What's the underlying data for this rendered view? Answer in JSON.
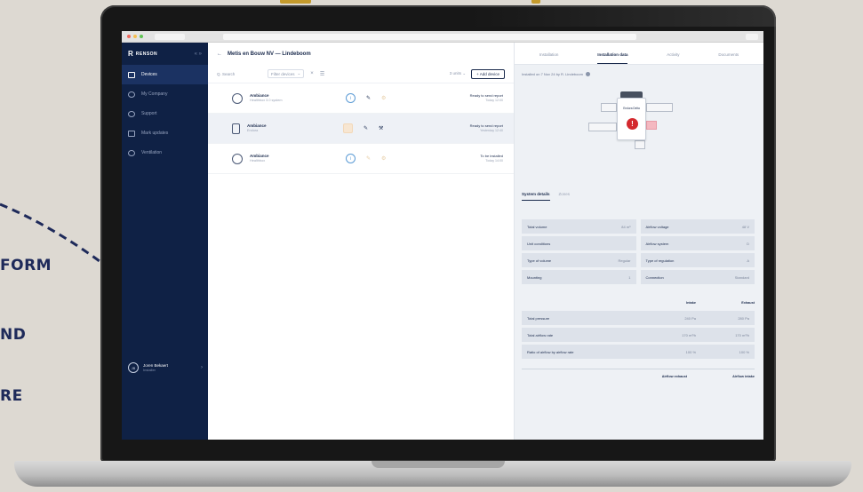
{
  "background": {
    "words": [
      "FORM",
      "ND",
      "RE"
    ],
    "colors": {
      "text": "#1e2a5a",
      "accent": "#c49a2c",
      "page": "#ddd9d2"
    }
  },
  "brand": {
    "mark": "R",
    "name": "RENSON",
    "toggle": "« »"
  },
  "sidebar": {
    "items": [
      {
        "label": "Devices",
        "icon": "devices-icon",
        "active": true
      },
      {
        "label": "My Company",
        "icon": "company-icon"
      },
      {
        "label": "Support",
        "icon": "support-icon"
      },
      {
        "label": "Mark updates",
        "icon": "updates-icon"
      },
      {
        "label": "Ventilation",
        "icon": "ventilation-icon"
      }
    ],
    "user": {
      "initials": "JB",
      "name": "Joren Bekaert",
      "sub": "Installer",
      "chevron": "›"
    }
  },
  "main": {
    "back": "←",
    "title": "Metis en Bouw NV — Lindeboom",
    "search_placeholder": "Q. Search",
    "search_icon": "⌕",
    "filter_label": "Filter devices",
    "filter_chevron": "⌄",
    "filter_close": "×",
    "sort_icon": "☰",
    "count_label": "3 units",
    "count_chevron": "⌄",
    "add_label": "+ Add device",
    "devices": [
      {
        "name": "Ambiance",
        "sub": "Healthbox 3.0 system",
        "status_icon": "i",
        "tool_icon": "✎",
        "extra_icon": "⚙",
        "status_main": "Ready to send report",
        "status_sub": "Today 12:00",
        "icon_shape": "round",
        "selected": false
      },
      {
        "name": "Ambiance",
        "sub": "Endura",
        "status_icon": "",
        "tool_icon": "✎",
        "extra_icon": "⚒",
        "status_main": "Ready to send report",
        "status_sub": "Yesterday 12:40",
        "icon_shape": "square",
        "selected": true
      },
      {
        "name": "Ambiance",
        "sub": "Healthbox",
        "status_icon": "i",
        "tool_icon": "✎",
        "extra_icon": "⚙",
        "status_main": "To be installed",
        "status_sub": "Today 14:00",
        "icon_shape": "round",
        "selected": false
      }
    ]
  },
  "details": {
    "tabs": [
      {
        "label": "Installation",
        "active": false
      },
      {
        "label": "Installation data",
        "active": true
      },
      {
        "label": "Activity",
        "active": false
      },
      {
        "label": "Documents",
        "active": false
      }
    ],
    "caption": "Installed on 7 Nov 24 by R. Lindeboom",
    "unit_label": "Endura Delta",
    "alert": "!",
    "sub_tabs": [
      {
        "label": "System details",
        "active": true
      },
      {
        "label": "Zones",
        "active": false
      }
    ],
    "fields": [
      {
        "label": "Total volume",
        "value": "84 m³"
      },
      {
        "label": "Airflow voltage",
        "value": "48 V"
      },
      {
        "label": "Unit conditions",
        "value": ""
      },
      {
        "label": "Airflow system",
        "value": "D"
      },
      {
        "label": "Type of volume",
        "value": "Regular"
      },
      {
        "label": "Type of regulation",
        "value": "A"
      },
      {
        "label": "Mounting",
        "value": "1"
      },
      {
        "label": "Connection",
        "value": "Standard"
      }
    ],
    "flow_headers": [
      "Intake",
      "Exhaust"
    ],
    "flows": [
      {
        "label": "Total pressure",
        "intake": "240 Pa",
        "exhaust": "280 Pa"
      },
      {
        "label": "Total airflow rate",
        "intake": "170 m³/h",
        "exhaust": "170 m³/h"
      },
      {
        "label": "Ratio of airflow by airflow rate",
        "intake": "100 %",
        "exhaust": "100 %"
      }
    ],
    "footer_headers": [
      "Airflow exhaust",
      "Airflow intake"
    ]
  }
}
